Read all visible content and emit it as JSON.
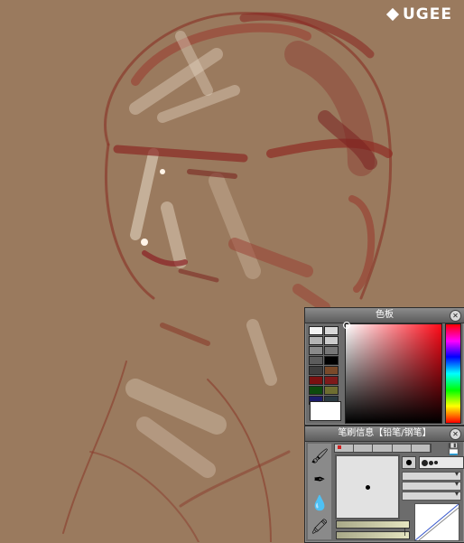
{
  "brand": {
    "logo_text": "UGEE"
  },
  "canvas": {
    "description_colors": {
      "background": "#9a7a5e",
      "stroke_dark": "#8a2e24",
      "stroke_light": "#e6d8c6"
    }
  },
  "color_panel": {
    "title": "色板",
    "swatches": [
      "#f4f4f4",
      "#d8d8d8",
      "#b4b4b4",
      "#cccccc",
      "#8a8a8a",
      "#777777",
      "#5c5c5c",
      "#000000",
      "#3e3e3e",
      "#7a4a2a",
      "#7a1010",
      "#7e1a1a",
      "#0d4a0d",
      "#6e6e30",
      "#1c1c6a",
      "#2a3a40"
    ],
    "current_color": "#ffffff",
    "hue_color": "#ff0a18"
  },
  "brush_panel": {
    "title": "笔刷信息【铅笔/钢笔】",
    "tool_icons": [
      "brush-icon",
      "airbrush-icon",
      "water-drop-icon",
      "marker-icon"
    ],
    "tip_label": "●"
  }
}
